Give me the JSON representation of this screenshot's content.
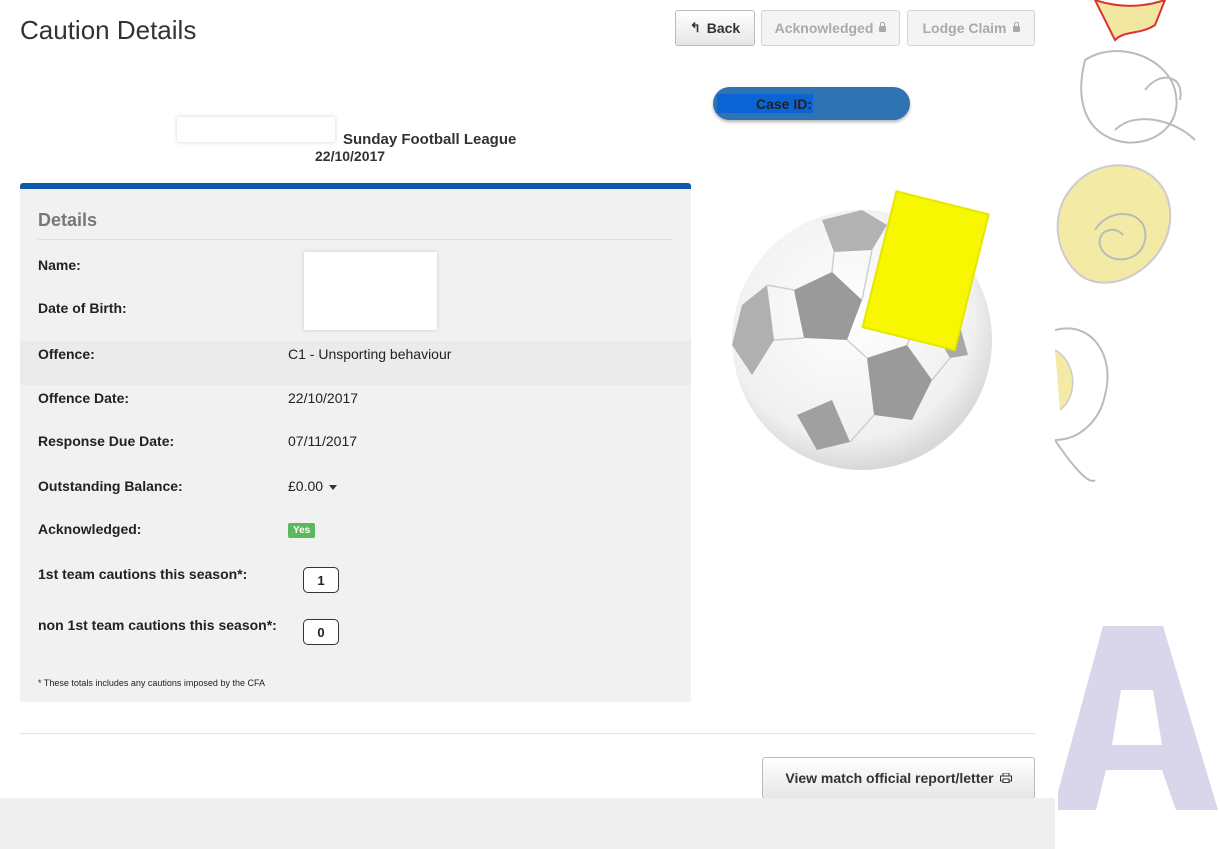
{
  "header": {
    "title": "Caution Details",
    "back_label": "Back",
    "acknowledged_label": "Acknowledged",
    "lodge_claim_label": "Lodge Claim"
  },
  "case": {
    "label": "Case ID:"
  },
  "match": {
    "league": "Sunday Football League",
    "date": "22/10/2017"
  },
  "details": {
    "heading": "Details",
    "fields": {
      "name_label": "Name:",
      "dob_label": "Date of Birth:",
      "offence_label": "Offence:",
      "offence_value": "C1 - Unsporting behaviour",
      "offence_date_label": "Offence Date:",
      "offence_date_value": "22/10/2017",
      "response_due_label": "Response Due Date:",
      "response_due_value": "07/11/2017",
      "balance_label": "Outstanding Balance:",
      "balance_value": "£0.00",
      "acknowledged_label": "Acknowledged:",
      "acknowledged_value": "Yes",
      "first_team_label": "1st team cautions this season*:",
      "first_team_value": "1",
      "non_first_team_label": "non 1st team cautions this season*:",
      "non_first_team_value": "0"
    },
    "footnote": "* These totals includes any cautions imposed by the CFA"
  },
  "actions": {
    "report_label": "View match official report/letter"
  },
  "colors": {
    "accent": "#0d5aa7",
    "case_pill": "#2f73b2",
    "badge": "#5cb85c",
    "yellow_card": "#f7f700",
    "deco_letter": "#d9d6ec"
  }
}
